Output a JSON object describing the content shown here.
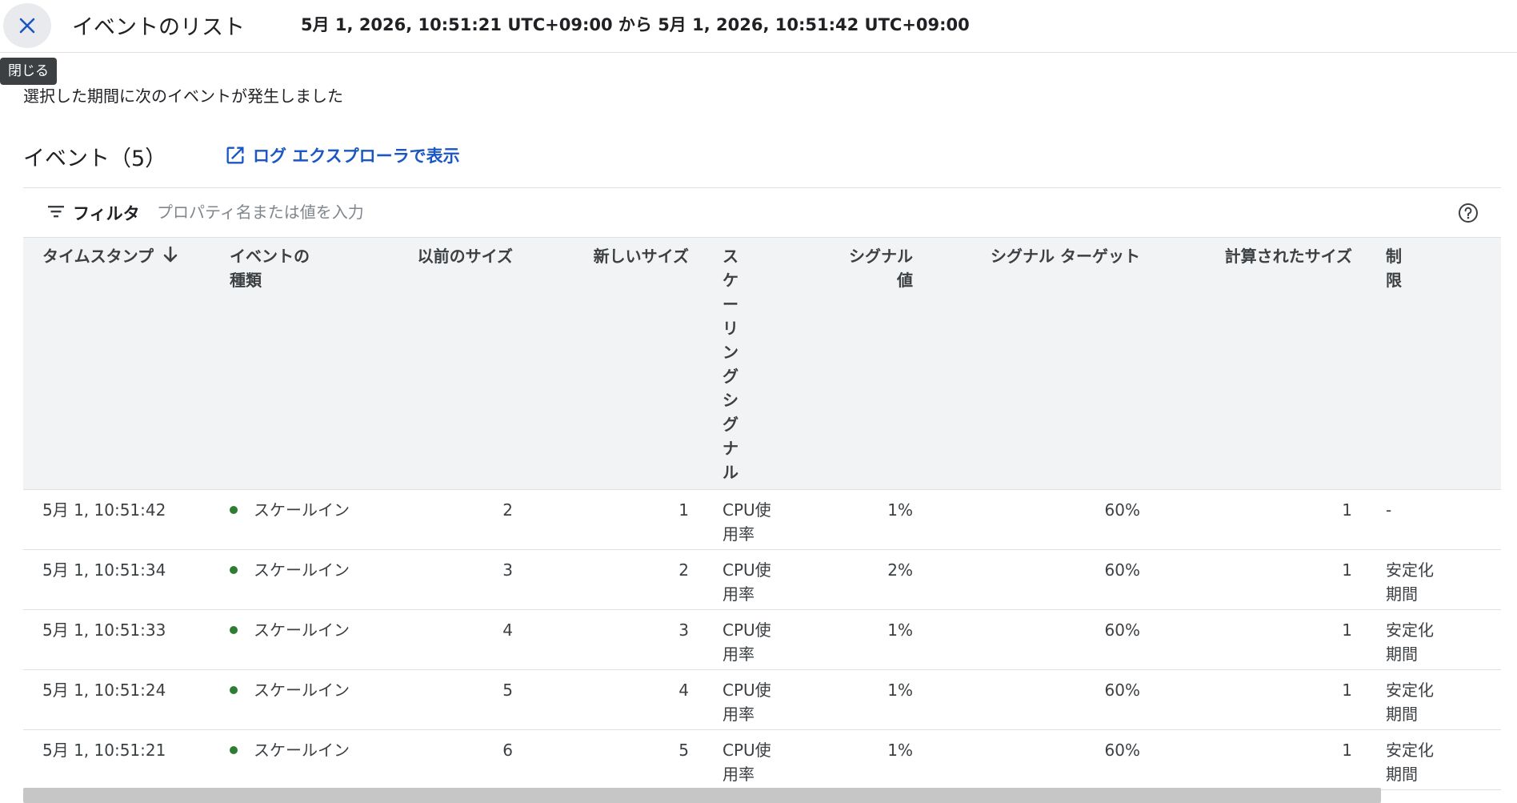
{
  "header": {
    "title": "イベントのリスト",
    "range": "5月 1, 2026, 10:51:21 UTC+09:00 から 5月 1, 2026, 10:51:42 UTC+09:00",
    "close_tooltip": "閉じる"
  },
  "description": "選択した期間に次のイベントが発生しました",
  "events_section": {
    "title": "イベント（5）",
    "log_link": "ログ エクスプローラで表示"
  },
  "filter": {
    "label": "フィルタ",
    "placeholder": "プロパティ名または値を入力"
  },
  "table": {
    "columns": [
      "タイムスタンプ",
      "イベントの種類",
      "以前のサイズ",
      "新しいサイズ",
      "スケーリングシグナル",
      "シグナル値",
      "シグナル ターゲット",
      "計算されたサイズ",
      "制限"
    ],
    "rows": [
      {
        "timestamp": "5月 1, 10:51:42",
        "type": "スケールイン",
        "prev": "2",
        "new": "1",
        "signal": "CPU使用率",
        "value": "1%",
        "target": "60%",
        "computed": "1",
        "limit": "-"
      },
      {
        "timestamp": "5月 1, 10:51:34",
        "type": "スケールイン",
        "prev": "3",
        "new": "2",
        "signal": "CPU使用率",
        "value": "2%",
        "target": "60%",
        "computed": "1",
        "limit": "安定化期間"
      },
      {
        "timestamp": "5月 1, 10:51:33",
        "type": "スケールイン",
        "prev": "4",
        "new": "3",
        "signal": "CPU使用率",
        "value": "1%",
        "target": "60%",
        "computed": "1",
        "limit": "安定化期間"
      },
      {
        "timestamp": "5月 1, 10:51:24",
        "type": "スケールイン",
        "prev": "5",
        "new": "4",
        "signal": "CPU使用率",
        "value": "1%",
        "target": "60%",
        "computed": "1",
        "limit": "安定化期間"
      },
      {
        "timestamp": "5月 1, 10:51:21",
        "type": "スケールイン",
        "prev": "6",
        "new": "5",
        "signal": "CPU使用率",
        "value": "1%",
        "target": "60%",
        "computed": "1",
        "limit": "安定化期間"
      }
    ]
  },
  "colors": {
    "accent": "#1a56c4",
    "status_dot": "#2e7d32",
    "header_bg": "#f1f3f4"
  },
  "icons": {
    "close": "close-icon",
    "open_in_new": "open-in-new-icon",
    "filter": "filter-icon",
    "help": "help-icon",
    "sort": "arrow-down-icon"
  }
}
